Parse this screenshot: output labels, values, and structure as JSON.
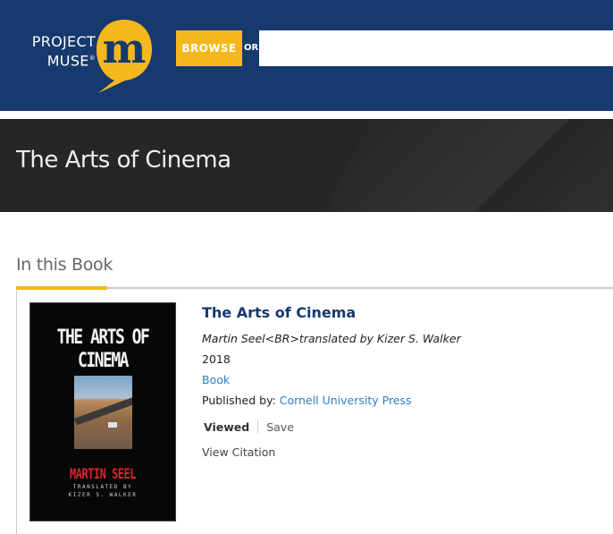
{
  "header": {
    "logo_line1": "PROJECT",
    "logo_line2": "MUSE",
    "logo_mark": "®",
    "logo_badge_letter": "m",
    "browse_label": "BROWSE",
    "or_label": "OR",
    "search_value": ""
  },
  "banner": {
    "title": "The Arts of Cinema"
  },
  "section": {
    "heading": "In this Book"
  },
  "book": {
    "cover": {
      "title": "THE ARTS OF CINEMA",
      "author": "MARTIN SEEL",
      "translated_line1": "TRANSLATED BY",
      "translated_line2": "KIZER S. WALKER"
    },
    "title": "The Arts of Cinema",
    "authors": "Martin Seel<BR>translated by Kizer S. Walker",
    "year": "2018",
    "type": "Book",
    "publisher_label": "Published by: ",
    "publisher_name": "Cornell University Press",
    "viewed_label": "Viewed",
    "save_label": "Save",
    "citation_label": "View Citation"
  },
  "colors": {
    "brand_navy": "#16396e",
    "accent_yellow": "#f5b81c",
    "link_blue": "#2e7fbf",
    "banner_dark": "#262626"
  }
}
